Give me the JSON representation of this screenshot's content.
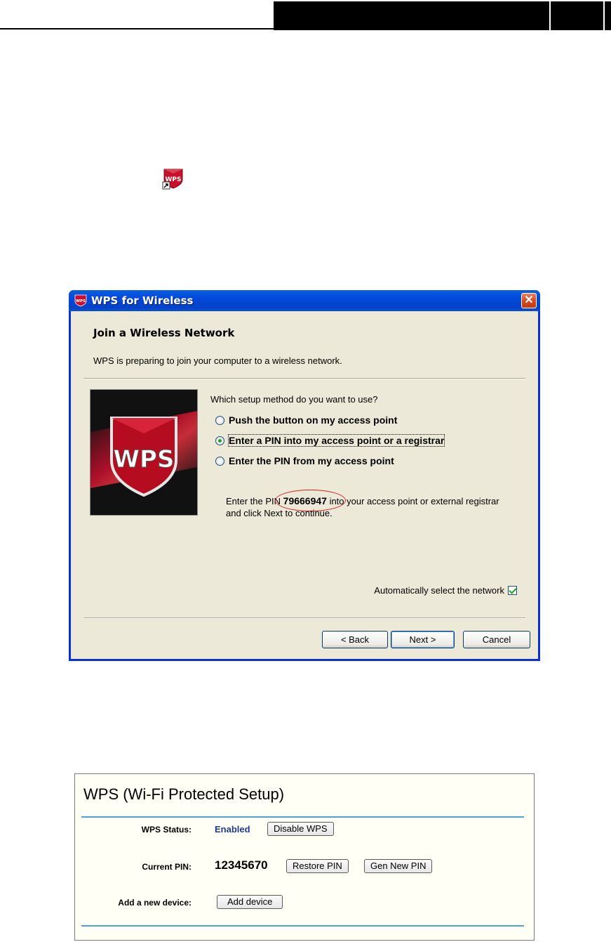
{
  "dialog": {
    "title": "WPS for Wireless",
    "close_glyph": "✕",
    "heading": "Join a Wireless Network",
    "subtext": "WPS is preparing to join your computer to a wireless network.",
    "question": "Which setup method do you want to use?",
    "options": [
      {
        "label": "Push the button on my access point",
        "selected": false
      },
      {
        "label": "Enter a PIN into my access point or a registrar",
        "selected": true
      },
      {
        "label": "Enter the PIN from my access point",
        "selected": false
      }
    ],
    "pin_prefix": "Enter the PIN ",
    "pin": "79666947",
    "pin_suffix": " into your access point or external registrar",
    "pin_line2": "and click Next to continue.",
    "auto_select_label": "Automatically select the network",
    "auto_select_checked": true,
    "buttons": {
      "back": "< Back",
      "next": "Next >",
      "cancel": "Cancel"
    }
  },
  "router": {
    "title": "WPS (Wi-Fi Protected Setup)",
    "wps_status_label": "WPS Status:",
    "wps_status_value": "Enabled",
    "disable_button": "Disable WPS",
    "current_pin_label": "Current PIN:",
    "current_pin_value": "12345670",
    "restore_button": "Restore PIN",
    "gen_button": "Gen New PIN",
    "add_device_label": "Add a new device:",
    "add_device_button": "Add device"
  },
  "icons": {
    "desktop": "wps-shortcut-icon",
    "title": "wps-app-icon",
    "brand": "wps-shield-logo"
  },
  "colors": {
    "titlebar": "#0348d9",
    "dialog_bg": "#ece9d8",
    "status_enabled": "#1f3a93",
    "accent_line": "#4fa3d2",
    "pin_circle": "#d0262a"
  },
  "logo_text": "WPS"
}
